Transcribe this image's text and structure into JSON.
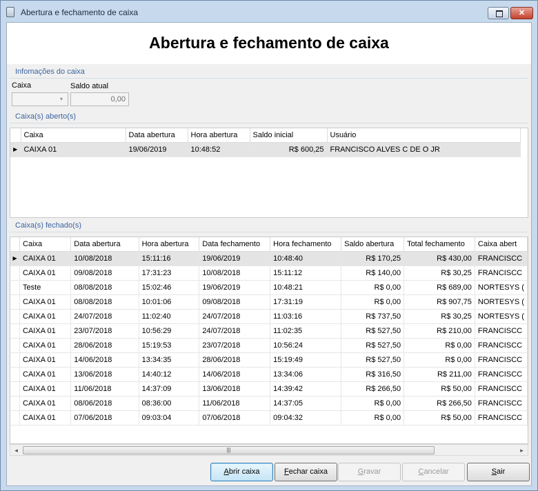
{
  "window": {
    "title": "Abertura e fechamento de caixa",
    "close_glyph": "✕",
    "icon": "cash-register-icon"
  },
  "header": {
    "title": "Abertura e fechamento de caixa"
  },
  "info": {
    "group_title": "Infomações do caixa",
    "caixa_label": "Caixa",
    "saldo_label": "Saldo atual",
    "saldo_value": "0,00"
  },
  "abertos": {
    "group_title": "Caixa(s) aberto(s)",
    "columns": [
      "Caixa",
      "Data abertura",
      "Hora abertura",
      "Saldo inicial",
      "Usuário"
    ],
    "rows": [
      [
        "CAIXA 01",
        "19/06/2019",
        "10:48:52",
        "R$ 600,25",
        "FRANCISCO ALVES C DE O JR"
      ]
    ]
  },
  "fechados": {
    "group_title": "Caixa(s) fechado(s)",
    "columns": [
      "Caixa",
      "Data abertura",
      "Hora abertura",
      "Data fechamento",
      "Hora fechamento",
      "Saldo abertura",
      "Total fechamento",
      "Caixa abert"
    ],
    "rows": [
      [
        "CAIXA 01",
        "10/08/2018",
        "15:11:16",
        "19/06/2019",
        "10:48:40",
        "R$ 170,25",
        "R$ 430,00",
        "FRANCISCC"
      ],
      [
        "CAIXA 01",
        "09/08/2018",
        "17:31:23",
        "10/08/2018",
        "15:11:12",
        "R$ 140,00",
        "R$ 30,25",
        "FRANCISCC"
      ],
      [
        "Teste",
        "08/08/2018",
        "15:02:46",
        "19/06/2019",
        "10:48:21",
        "R$ 0,00",
        "R$ 689,00",
        "NORTESYS ("
      ],
      [
        "CAIXA 01",
        "08/08/2018",
        "10:01:06",
        "09/08/2018",
        "17:31:19",
        "R$ 0,00",
        "R$ 907,75",
        "NORTESYS ("
      ],
      [
        "CAIXA 01",
        "24/07/2018",
        "11:02:40",
        "24/07/2018",
        "11:03:16",
        "R$ 737,50",
        "R$ 30,25",
        "NORTESYS ("
      ],
      [
        "CAIXA 01",
        "23/07/2018",
        "10:56:29",
        "24/07/2018",
        "11:02:35",
        "R$ 527,50",
        "R$ 210,00",
        "FRANCISCC"
      ],
      [
        "CAIXA 01",
        "28/06/2018",
        "15:19:53",
        "23/07/2018",
        "10:56:24",
        "R$ 527,50",
        "R$ 0,00",
        "FRANCISCC"
      ],
      [
        "CAIXA 01",
        "14/06/2018",
        "13:34:35",
        "28/06/2018",
        "15:19:49",
        "R$ 527,50",
        "R$ 0,00",
        "FRANCISCC"
      ],
      [
        "CAIXA 01",
        "13/06/2018",
        "14:40:12",
        "14/06/2018",
        "13:34:06",
        "R$ 316,50",
        "R$ 211,00",
        "FRANCISCC"
      ],
      [
        "CAIXA 01",
        "11/06/2018",
        "14:37:09",
        "13/06/2018",
        "14:39:42",
        "R$ 266,50",
        "R$ 50,00",
        "FRANCISCC"
      ],
      [
        "CAIXA 01",
        "08/06/2018",
        "08:36:00",
        "11/06/2018",
        "14:37:05",
        "R$ 0,00",
        "R$ 266,50",
        "FRANCISCC"
      ],
      [
        "CAIXA 01",
        "07/06/2018",
        "09:03:04",
        "07/06/2018",
        "09:04:32",
        "R$ 0,00",
        "R$ 50,00",
        "FRANCISCC"
      ]
    ]
  },
  "scrollbar": {
    "left_glyph": "◂",
    "right_glyph": "▸",
    "grip_glyph": "|||"
  },
  "row_indicator": "▶",
  "combo_arrow": "▾",
  "buttons": {
    "abrir": {
      "first": "A",
      "rest": "brir caixa"
    },
    "fechar": {
      "first": "F",
      "rest": "echar caixa"
    },
    "gravar": {
      "first": "G",
      "rest": "ravar"
    },
    "cancelar": {
      "first": "C",
      "rest": "ancelar"
    },
    "sair": {
      "first": "S",
      "rest": "air"
    }
  }
}
